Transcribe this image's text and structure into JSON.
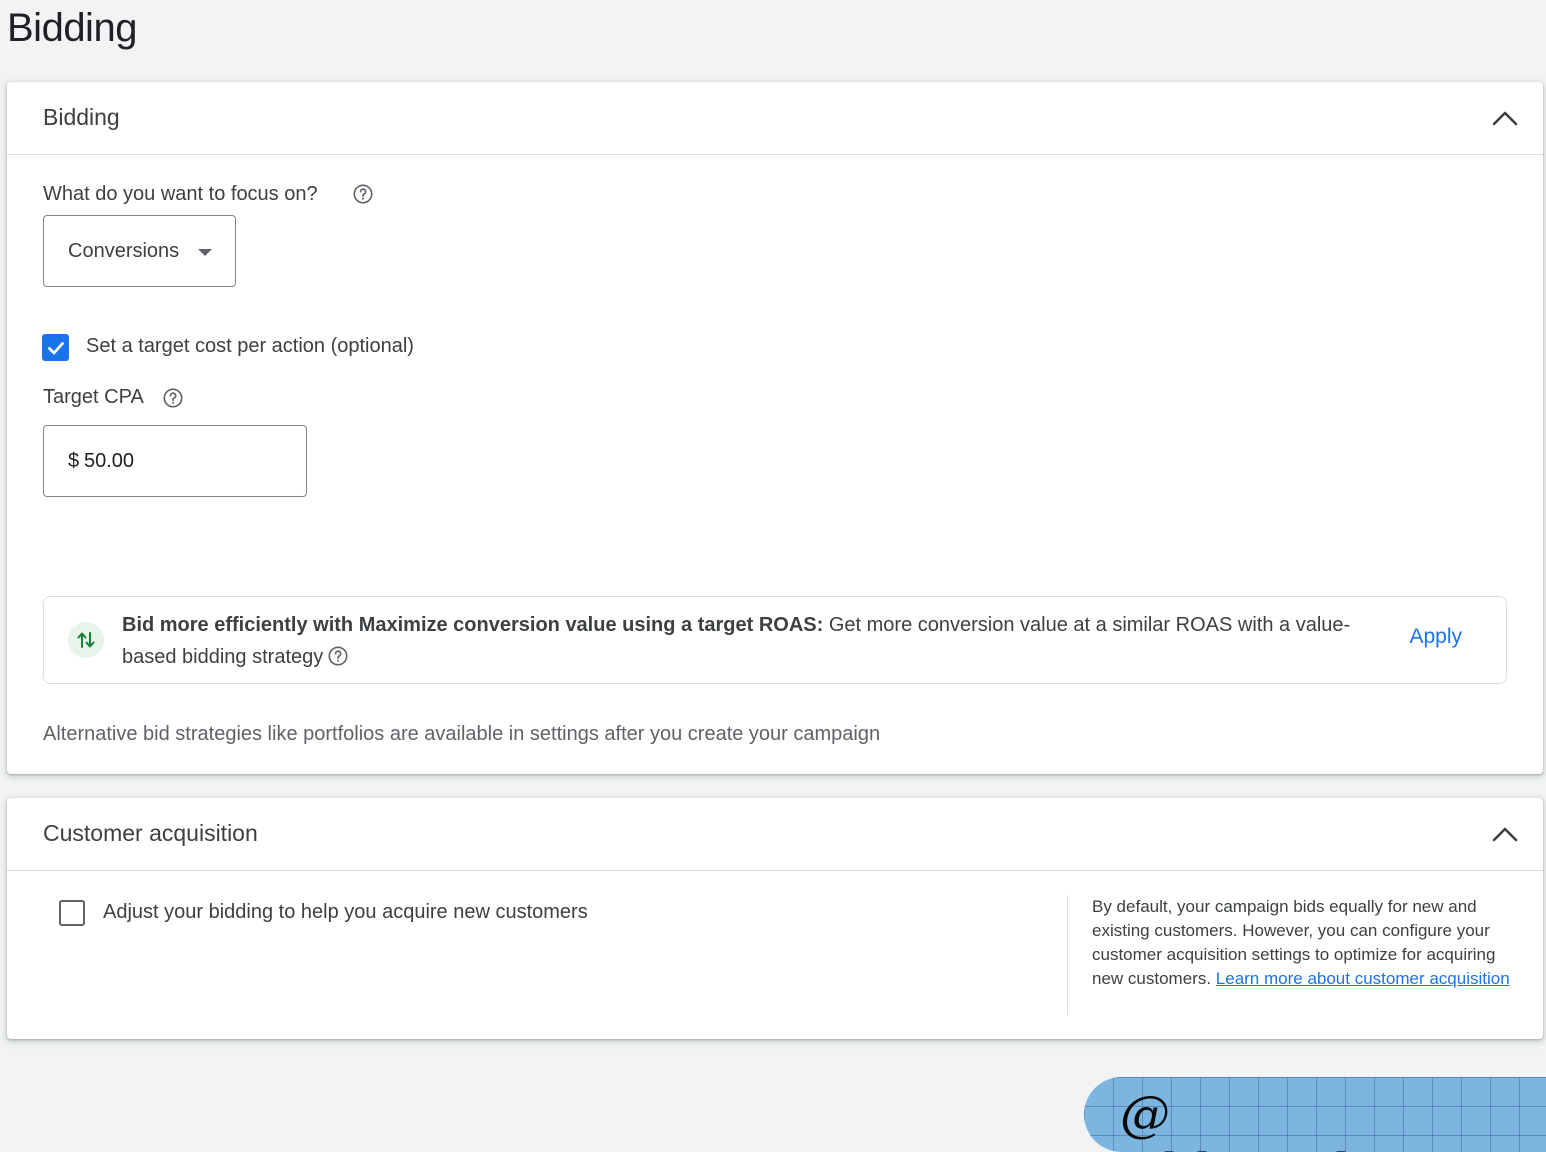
{
  "page": {
    "title": "Bidding"
  },
  "bidding": {
    "header": "Bidding",
    "focus_question": "What do you want to focus on?",
    "focus_selected": "Conversions",
    "target_cpa_checkbox_label": "Set a target cost per action (optional)",
    "target_cpa_checked": true,
    "target_cpa_label": "Target CPA",
    "currency_symbol": "$",
    "target_cpa_value": "50.00",
    "recommendation": {
      "title": "Bid more efficiently with Maximize conversion value using a target ROAS:",
      "body": "Get more conversion value at a similar ROAS with a value-based bidding strategy",
      "apply_label": "Apply"
    },
    "alternative_note": "Alternative bid strategies like portfolios are available in settings after you create your campaign"
  },
  "customer_acquisition": {
    "header": "Customer acquisition",
    "checkbox_label": "Adjust your bidding to help you acquire new customers",
    "checked": false,
    "info_text": "By default, your campaign bids equally for new and existing customers. However, you can configure your customer acquisition settings to optimize for acquiring new customers.",
    "learn_more_link": "Learn more about customer acquisition"
  },
  "watermark": {
    "text": "@ Chloevolution"
  },
  "colors": {
    "accent": "#1a73e8",
    "reco_icon_bg": "#e6f4ea",
    "reco_icon": "#188038"
  },
  "icons": [
    "chevron-up-icon",
    "help-icon",
    "dropdown-arrow-icon",
    "check-icon",
    "trending-arrows-icon"
  ]
}
